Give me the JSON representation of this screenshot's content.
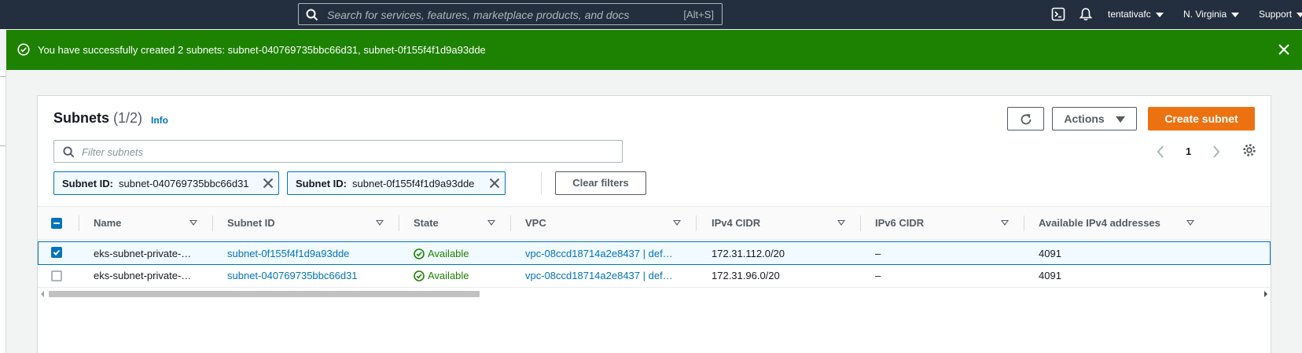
{
  "nav": {
    "search_placeholder": "Search for services, features, marketplace products, and docs",
    "search_shortcut": "[Alt+S]",
    "account": "tentativafc",
    "region": "N. Virginia",
    "support": "Support"
  },
  "flash": {
    "message": "You have successfully created 2 subnets: subnet-040769735bbc66d31, subnet-0f155f4f1d9a93dde",
    "color": "#1d8102"
  },
  "panel": {
    "title": "Subnets",
    "count": "(1/2)",
    "info": "Info",
    "actions_label": "Actions",
    "create_label": "Create subnet",
    "filter_placeholder": "Filter subnets",
    "page": "1",
    "tokens": [
      {
        "key": "Subnet ID:",
        "value": "subnet-040769735bbc66d31"
      },
      {
        "key": "Subnet ID:",
        "value": "subnet-0f155f4f1d9a93dde"
      }
    ],
    "clear_filters": "Clear filters"
  },
  "table": {
    "columns": [
      "Name",
      "Subnet ID",
      "State",
      "VPC",
      "IPv4 CIDR",
      "IPv6 CIDR",
      "Available IPv4 addresses"
    ],
    "rows": [
      {
        "selected": true,
        "name": "eks-subnet-private-…",
        "subnet_id": "subnet-0f155f4f1d9a93dde",
        "state": "Available",
        "vpc": "vpc-08ccd18714a2e8437 | def…",
        "ipv4": "172.31.112.0/20",
        "ipv6": "–",
        "available": "4091"
      },
      {
        "selected": false,
        "name": "eks-subnet-private-…",
        "subnet_id": "subnet-040769735bbc66d31",
        "state": "Available",
        "vpc": "vpc-08ccd18714a2e8437 | def…",
        "ipv4": "172.31.96.0/20",
        "ipv6": "–",
        "available": "4091"
      }
    ]
  },
  "colors": {
    "nav_bg": "#232f3e",
    "primary": "#ec7211",
    "link": "#0073bb",
    "success": "#1d8102"
  }
}
